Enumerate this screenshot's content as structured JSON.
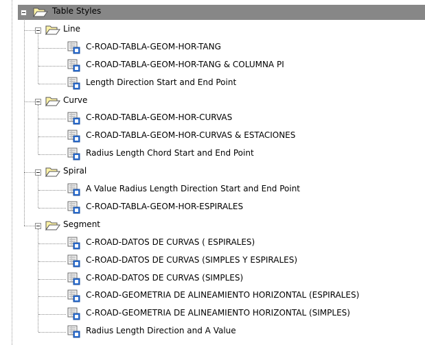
{
  "tree": {
    "root": {
      "label": "Table Styles",
      "icon": "folder-open-icon",
      "expanded": true,
      "selected": true
    },
    "groups": [
      {
        "label": "Line",
        "icon": "folder-open-icon",
        "expanded": true,
        "items": [
          "C-ROAD-TABLA-GEOM-HOR-TANG",
          "C-ROAD-TABLA-GEOM-HOR-TANG & COLUMNA PI",
          "Length Direction Start and End Point"
        ]
      },
      {
        "label": "Curve",
        "icon": "folder-open-icon",
        "expanded": true,
        "items": [
          "C-ROAD-TABLA-GEOM-HOR-CURVAS",
          "C-ROAD-TABLA-GEOM-HOR-CURVAS & ESTACIONES",
          "Radius Length Chord Start and End Point"
        ]
      },
      {
        "label": "Spiral",
        "icon": "folder-open-icon",
        "expanded": true,
        "items": [
          "A Value Radius Length Direction Start and End Point",
          "C-ROAD-TABLA-GEOM-HOR-ESPIRALES"
        ]
      },
      {
        "label": "Segment",
        "icon": "folder-open-icon",
        "expanded": true,
        "items": [
          "C-ROAD-DATOS DE CURVAS ( ESPIRALES)",
          "C-ROAD-DATOS DE CURVAS (SIMPLES Y ESPIRALES)",
          "C-ROAD-DATOS DE CURVAS (SIMPLES)",
          "C-ROAD-GEOMETRIA DE ALINEAMIENTO HORIZONTAL (ESPIRALES)",
          "C-ROAD-GEOMETRIA DE ALINEAMIENTO HORIZONTAL (SIMPLES)",
          "Radius Length Direction and A Value"
        ]
      }
    ],
    "item_icon": "table-style-icon",
    "colors": {
      "selection": "#878787",
      "folder": "#fff3a6",
      "icon_blue": "#2a6fd6"
    }
  }
}
